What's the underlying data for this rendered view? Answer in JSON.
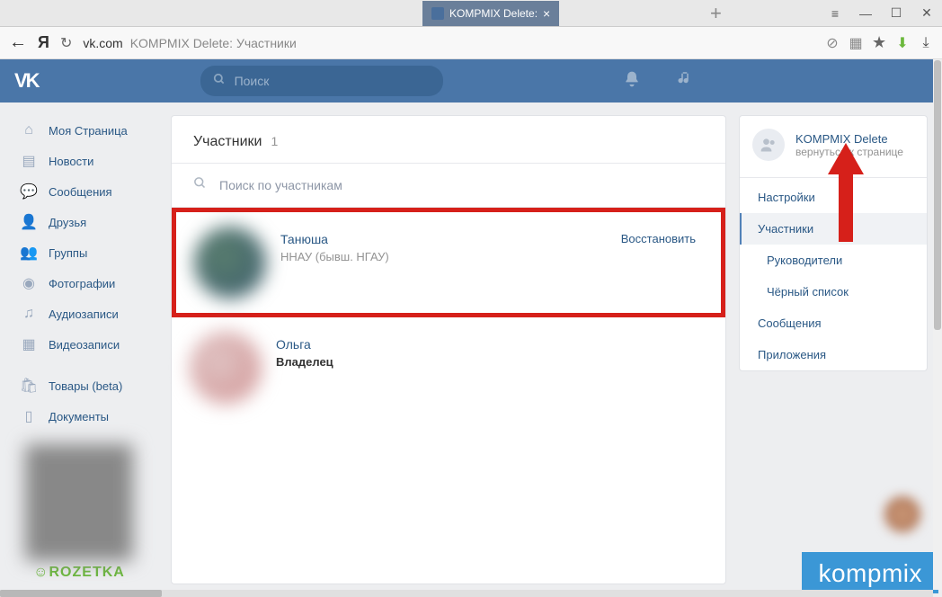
{
  "browser": {
    "tab_title": "KOMPMIX Delete:",
    "url_domain": "vk.com",
    "url_title": "KOMPMIX Delete: Участники"
  },
  "vk_search_placeholder": "Поиск",
  "left_nav": [
    {
      "icon": "home",
      "label": "Моя Страница"
    },
    {
      "icon": "news",
      "label": "Новости"
    },
    {
      "icon": "msg",
      "label": "Сообщения"
    },
    {
      "icon": "friends",
      "label": "Друзья"
    },
    {
      "icon": "groups",
      "label": "Группы"
    },
    {
      "icon": "photos",
      "label": "Фотографии"
    },
    {
      "icon": "audio",
      "label": "Аудиозаписи"
    },
    {
      "icon": "video",
      "label": "Видеозаписи"
    },
    {
      "icon": "market",
      "label": "Товары (beta)"
    },
    {
      "icon": "docs",
      "label": "Документы"
    }
  ],
  "panel": {
    "title": "Участники",
    "count": "1",
    "search_placeholder": "Поиск по участникам"
  },
  "members": [
    {
      "name": "Танюша",
      "subtitle": "ННАУ (бывш. НГАУ)",
      "action": "Восстановить",
      "role": ""
    },
    {
      "name": "Ольга",
      "subtitle": "",
      "action": "",
      "role": "Владелец"
    }
  ],
  "right": {
    "group_name": "KOMPMIX Delete",
    "group_sub": "вернуться к странице",
    "menu": [
      {
        "label": "Настройки",
        "active": false,
        "sub": false
      },
      {
        "label": "Участники",
        "active": true,
        "sub": false
      },
      {
        "label": "Руководители",
        "active": false,
        "sub": true
      },
      {
        "label": "Чёрный список",
        "active": false,
        "sub": true
      },
      {
        "label": "Сообщения",
        "active": false,
        "sub": false
      },
      {
        "label": "Приложения",
        "active": false,
        "sub": false
      }
    ]
  },
  "ad_brand": "ROZETKA",
  "watermark": "kompmix"
}
